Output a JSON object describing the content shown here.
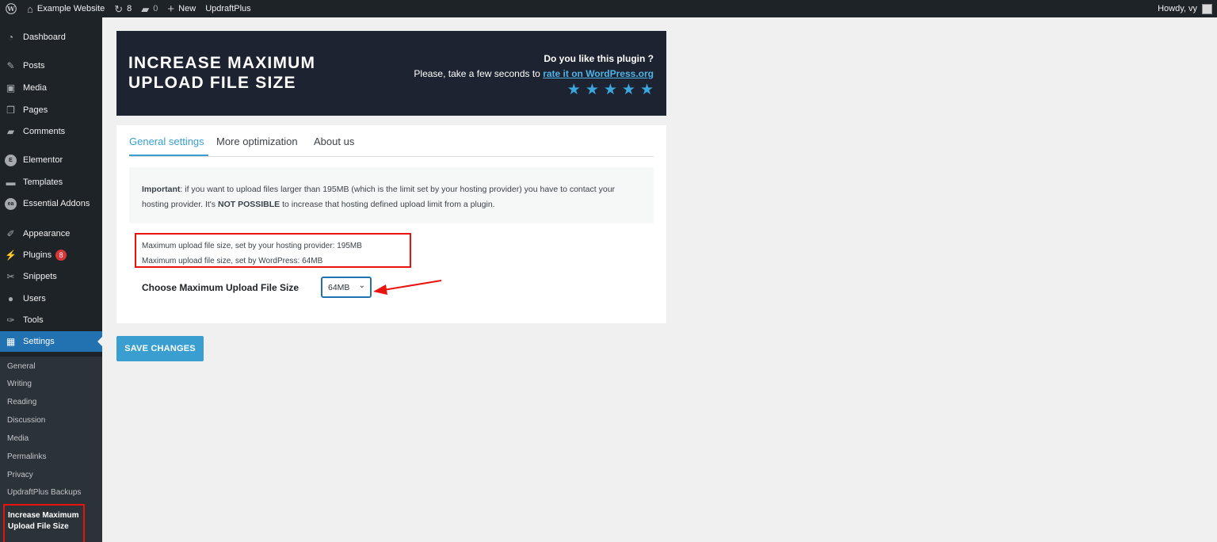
{
  "adminbar": {
    "site_name": "Example Website",
    "updates_count": "8",
    "comments_count": "0",
    "new_label": "New",
    "plugin_link": "UpdraftPlus",
    "greeting": "Howdy, vy"
  },
  "sidebar": {
    "items": [
      {
        "label": "Dashboard",
        "icon": "dashboard-icon"
      },
      {
        "label": "Posts",
        "icon": "pin-icon"
      },
      {
        "label": "Media",
        "icon": "media-icon"
      },
      {
        "label": "Pages",
        "icon": "pages-icon"
      },
      {
        "label": "Comments",
        "icon": "comment-icon"
      },
      {
        "label": "Elementor",
        "icon": "elementor-icon"
      },
      {
        "label": "Templates",
        "icon": "folder-icon"
      },
      {
        "label": "Essential Addons",
        "icon": "ea-icon"
      },
      {
        "label": "Appearance",
        "icon": "brush-icon"
      },
      {
        "label": "Plugins",
        "icon": "plugin-icon",
        "badge": "8"
      },
      {
        "label": "Snippets",
        "icon": "scissors-icon"
      },
      {
        "label": "Users",
        "icon": "user-icon"
      },
      {
        "label": "Tools",
        "icon": "wrench-icon"
      },
      {
        "label": "Settings",
        "icon": "settings-icon",
        "active": true
      }
    ],
    "submenu": [
      "General",
      "Writing",
      "Reading",
      "Discussion",
      "Media",
      "Permalinks",
      "Privacy",
      "UpdraftPlus Backups"
    ],
    "current_sub": "Increase Maximum Upload File Size"
  },
  "banner": {
    "title": "INCREASE MAXIMUM\nUPLOAD FILE SIZE",
    "question": "Do you like this plugin ?",
    "prompt": "Please, take a few seconds to",
    "link": "rate it on WordPress.org",
    "stars": 5
  },
  "tabs": [
    "General settings",
    "More optimization",
    "About us"
  ],
  "notice": {
    "strong": "Important",
    "text1": ": if you want to upload files larger than 195MB (which is the limit set by your hosting provider) you have to contact your hosting provider. It's ",
    "strong2": "NOT POSSIBLE",
    "text2": " to increase that hosting defined upload limit from a plugin."
  },
  "limits": {
    "host": "Maximum upload file size, set by your hosting provider: 195MB",
    "wordpress": "Maximum upload file size, set by WordPress: 64MB"
  },
  "choose": {
    "label": "Choose Maximum Upload File Size",
    "selected": "64MB"
  },
  "save_label": "SAVE CHANGES",
  "colors": {
    "accent": "#3a9fd0",
    "highlight": "#e8130c",
    "admin_dark": "#1d2327"
  }
}
